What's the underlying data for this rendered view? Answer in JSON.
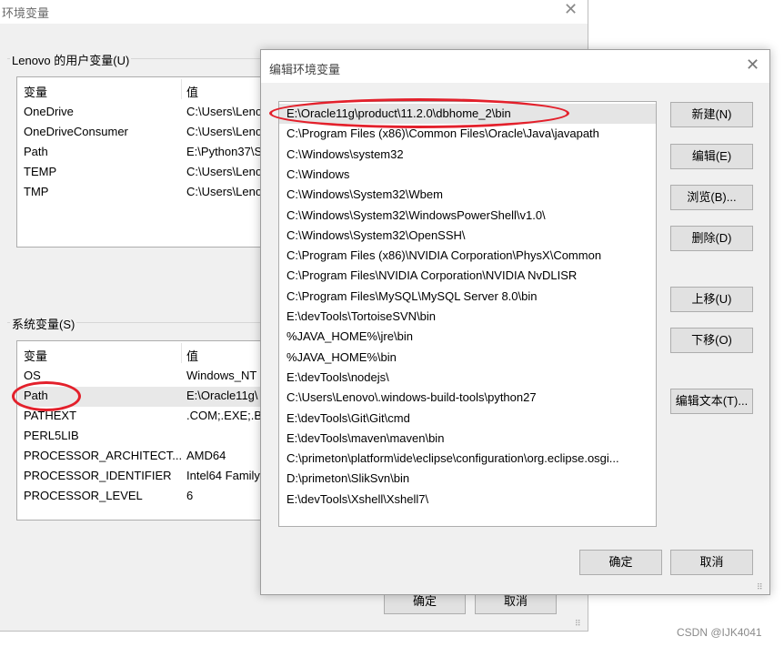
{
  "bg_window": {
    "title": "环境变量",
    "close_glyph": "✕",
    "user_group_label": "Lenovo 的用户变量(U)",
    "user_columns": [
      "变量",
      "值"
    ],
    "user_vars": [
      {
        "name": "OneDrive",
        "value": "C:\\Users\\Leno"
      },
      {
        "name": "OneDriveConsumer",
        "value": "C:\\Users\\Leno"
      },
      {
        "name": "Path",
        "value": "E:\\Python37\\S"
      },
      {
        "name": "TEMP",
        "value": "C:\\Users\\Leno"
      },
      {
        "name": "TMP",
        "value": "C:\\Users\\Leno"
      }
    ],
    "sys_group_label": "系统变量(S)",
    "sys_columns": [
      "变量",
      "值"
    ],
    "sys_vars": [
      {
        "name": "OS",
        "value": "Windows_NT"
      },
      {
        "name": "Path",
        "value": "E:\\Oracle11g\\"
      },
      {
        "name": "PATHEXT",
        "value": ".COM;.EXE;.BA"
      },
      {
        "name": "PERL5LIB",
        "value": ""
      },
      {
        "name": "PROCESSOR_ARCHITECT...",
        "value": "AMD64"
      },
      {
        "name": "PROCESSOR_IDENTIFIER",
        "value": "Intel64 Family"
      },
      {
        "name": "PROCESSOR_LEVEL",
        "value": "6"
      }
    ],
    "ok_label": "确定",
    "cancel_label": "取消"
  },
  "edit_dialog": {
    "title": "编辑环境变量",
    "close_glyph": "✕",
    "paths": [
      "E:\\Oracle11g\\product\\11.2.0\\dbhome_2\\bin",
      "C:\\Program Files (x86)\\Common Files\\Oracle\\Java\\javapath",
      "C:\\Windows\\system32",
      "C:\\Windows",
      "C:\\Windows\\System32\\Wbem",
      "C:\\Windows\\System32\\WindowsPowerShell\\v1.0\\",
      "C:\\Windows\\System32\\OpenSSH\\",
      "C:\\Program Files (x86)\\NVIDIA Corporation\\PhysX\\Common",
      "C:\\Program Files\\NVIDIA Corporation\\NVIDIA NvDLISR",
      "C:\\Program Files\\MySQL\\MySQL Server 8.0\\bin",
      "E:\\devTools\\TortoiseSVN\\bin",
      "%JAVA_HOME%\\jre\\bin",
      "%JAVA_HOME%\\bin",
      "E:\\devTools\\nodejs\\",
      "C:\\Users\\Lenovo\\.windows-build-tools\\python27",
      "E:\\devTools\\Git\\Git\\cmd",
      "E:\\devTools\\maven\\maven\\bin",
      "C:\\primeton\\platform\\ide\\eclipse\\configuration\\org.eclipse.osgi...",
      "D:\\primeton\\SlikSvn\\bin",
      "E:\\devTools\\Xshell\\Xshell7\\"
    ],
    "buttons": {
      "new": "新建(N)",
      "edit": "编辑(E)",
      "browse": "浏览(B)...",
      "delete": "删除(D)",
      "move_up": "上移(U)",
      "move_down": "下移(O)",
      "edit_text": "编辑文本(T)..."
    },
    "ok_label": "确定",
    "cancel_label": "取消"
  },
  "annotation_color": "#e3202b",
  "watermark": "CSDN @IJK4041"
}
